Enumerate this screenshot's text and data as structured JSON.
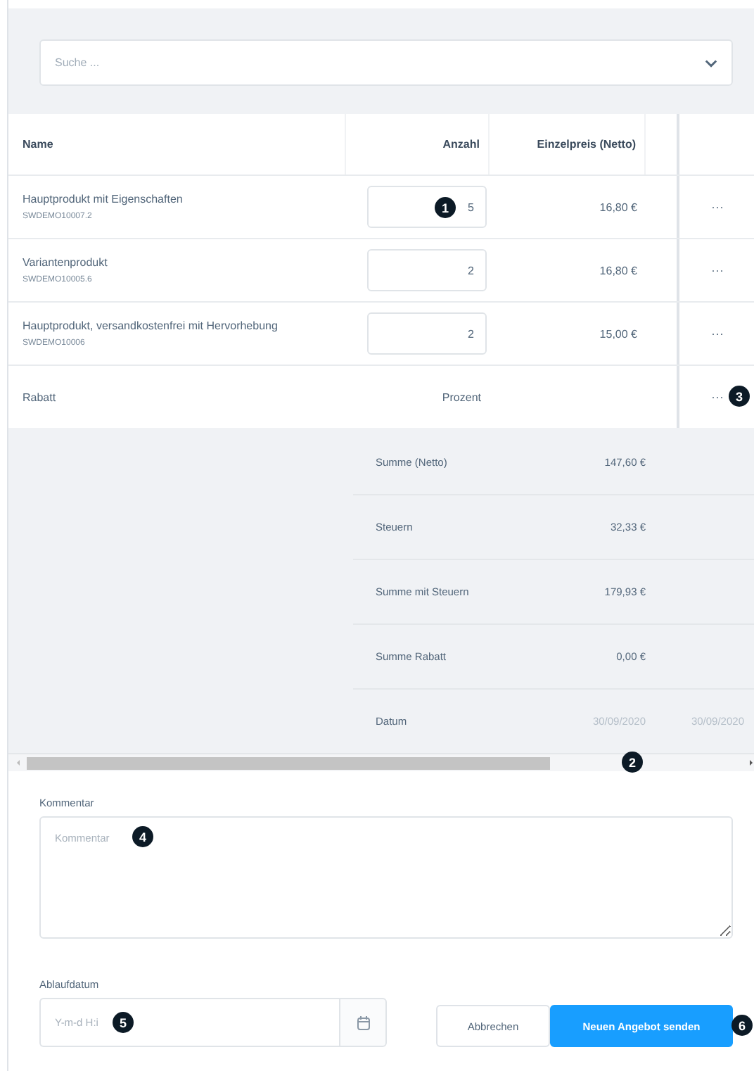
{
  "search": {
    "placeholder": "Suche ..."
  },
  "table": {
    "columns": [
      "Name",
      "Anzahl",
      "Einzelpreis (Netto)"
    ],
    "rows": [
      {
        "name": "Hauptprodukt mit Eigenschaften",
        "number": "SWDEMO10007.2",
        "quantity": "5",
        "unit_price": "16,80 €",
        "actions": "···",
        "marker": "1"
      },
      {
        "name": "Variantenprodukt",
        "number": "SWDEMO10005.6",
        "quantity": "2",
        "unit_price": "16,80 €",
        "actions": "···"
      },
      {
        "name": "Hauptprodukt, versandkostenfrei mit Hervorhebung",
        "number": "SWDEMO10006",
        "quantity": "2",
        "unit_price": "15,00 €",
        "actions": "···"
      }
    ],
    "discount_row": {
      "label": "Rabatt",
      "type": "Prozent",
      "actions": "···",
      "marker": "3"
    }
  },
  "summary": [
    {
      "label": "Summe (Netto)",
      "value": "147,60 €"
    },
    {
      "label": "Steuern",
      "value": "32,33 €"
    },
    {
      "label": "Summe mit Steuern",
      "value": "179,93 €"
    },
    {
      "label": "Summe Rabatt",
      "value": "0,00 €"
    },
    {
      "label": "Datum",
      "value": "30/09/2020",
      "value_2": "30/09/2020"
    }
  ],
  "scrollbar": {
    "marker": "2"
  },
  "comment": {
    "label": "Kommentar",
    "placeholder": "Kommentar",
    "marker": "4"
  },
  "expiry": {
    "label": "Ablaufdatum",
    "placeholder": "Y-m-d H:i",
    "marker": "5"
  },
  "buttons": [
    {
      "label": "Abbrechen",
      "kind": "secondary"
    },
    {
      "label": "Neuen Angebot senden",
      "kind": "primary",
      "marker": "6"
    }
  ]
}
